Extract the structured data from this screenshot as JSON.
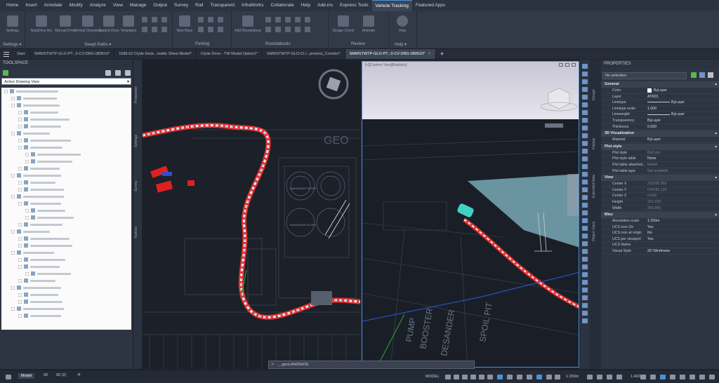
{
  "ribbon_tabs": [
    "Home",
    "Insert",
    "Annotate",
    "Modify",
    "Analyze",
    "View",
    "Manage",
    "Output",
    "Survey",
    "Rail",
    "Transparent",
    "InfraWorks",
    "Collaborate",
    "Help",
    "Add-ins",
    "Express Tools",
    "Vehicle Tracking",
    "Featured Apps"
  ],
  "active_ribbon_tab": "Vehicle Tracking",
  "ribbon": {
    "settings_label": "Settings",
    "autodrive_label": "AutoDrive Arc",
    "manual_drive_label": "Manual Drive",
    "vertical_clearance_label": "Vertical Clearance",
    "guided_drive_label": "Guided Drive",
    "templates_label": "Templates",
    "new_bays_label": "New Bays",
    "add_roundabout_label": "Add Roundabout",
    "design_check_label": "Design Check",
    "animate_label": "Animate",
    "help_label": "Help",
    "groups": [
      "Settings ▾",
      "Swept Paths ▾",
      "Parking",
      "Roundabouts",
      "Review",
      "Help ▾"
    ]
  },
  "file_tabs": [
    {
      "label": "Start",
      "active": false
    },
    {
      "label": "SMWSTWTP-GLO-PT...0-CV-DRG-080510*",
      "active": false
    },
    {
      "label": "1588-02 Clyde Deck...mattic Sheet Model*",
      "active": false
    },
    {
      "label": "Clyde Drive - TW Model Option1*",
      "active": false
    },
    {
      "label": "SMWSTWTP-GLO-CI.I...proents_Corridor*",
      "active": false
    },
    {
      "label": "SMWSTWTP-GLO-PT...0-CV-DRG-080510*",
      "active": true
    }
  ],
  "toolspace": {
    "title": "TOOLSPACE",
    "view": "Active Drawing View"
  },
  "toolspace_tabs": [
    "Prospector",
    "Settings",
    "Survey",
    "Toolbox"
  ],
  "viewport_right_label": "[+][Custom View][Realistic]",
  "viewport_left_text": "GEO",
  "viewport_labels": {
    "tank1": "ENHANCED FILTER",
    "tank2": "ENHANCED FILTER",
    "pump": "PUMP",
    "booster": "BOOSTER",
    "desander": "DESANDER",
    "spoil": "SPOIL PIT"
  },
  "properties": {
    "title": "PROPERTIES",
    "selection": "No selection",
    "sections": [
      {
        "name": "General",
        "rows": [
          {
            "k": "Color",
            "v": "ByLayer",
            "swatch": true
          },
          {
            "k": "Layer",
            "v": "ATR01"
          },
          {
            "k": "Linetype",
            "v": "ByLayer",
            "dash": true
          },
          {
            "k": "Linetype scale",
            "v": "1.000"
          },
          {
            "k": "Lineweight",
            "v": "ByLayer",
            "dash": true
          },
          {
            "k": "Transparency",
            "v": "ByLayer"
          },
          {
            "k": "Thickness",
            "v": "0.000"
          }
        ]
      },
      {
        "name": "3D Visualization",
        "rows": [
          {
            "k": "Material",
            "v": "ByLayer"
          }
        ]
      },
      {
        "name": "Plot style",
        "rows": [
          {
            "k": "Plot style",
            "v": "ByColor",
            "dim": true
          },
          {
            "k": "Plot style table",
            "v": "None"
          },
          {
            "k": "Plot table attached...",
            "v": "Model",
            "dim": true
          },
          {
            "k": "Plot table type",
            "v": "Not available",
            "dim": true
          }
        ]
      },
      {
        "name": "View",
        "rows": [
          {
            "k": "Center X",
            "v": "213205.003",
            "dim": true
          },
          {
            "k": "Center Y",
            "v": "674756.129",
            "dim": true
          },
          {
            "k": "Center Z",
            "v": "0.000",
            "dim": true
          },
          {
            "k": "Height",
            "v": "221.218",
            "dim": true
          },
          {
            "k": "Width",
            "v": "256.940",
            "dim": true
          }
        ]
      },
      {
        "name": "Misc",
        "rows": [
          {
            "k": "Annotation scale",
            "v": "1:250m"
          },
          {
            "k": "UCS icon On",
            "v": "Yes"
          },
          {
            "k": "UCS icon at origin",
            "v": "No"
          },
          {
            "k": "UCS per viewport",
            "v": "Yes"
          },
          {
            "k": "UCS Name",
            "v": ""
          },
          {
            "k": "Visual Style",
            "v": "2D Wireframe"
          }
        ]
      }
    ]
  },
  "properties_side_tabs": [
    "Design",
    "Display",
    "Extended Data",
    "Object Class"
  ],
  "statusbar": {
    "tabs": [
      "Model",
      "00",
      "00 (2)"
    ],
    "model": "MODEL",
    "scale": "1:250m",
    "zoom": "1.400"
  },
  "command_prompt": "_.geoLANDNATE"
}
